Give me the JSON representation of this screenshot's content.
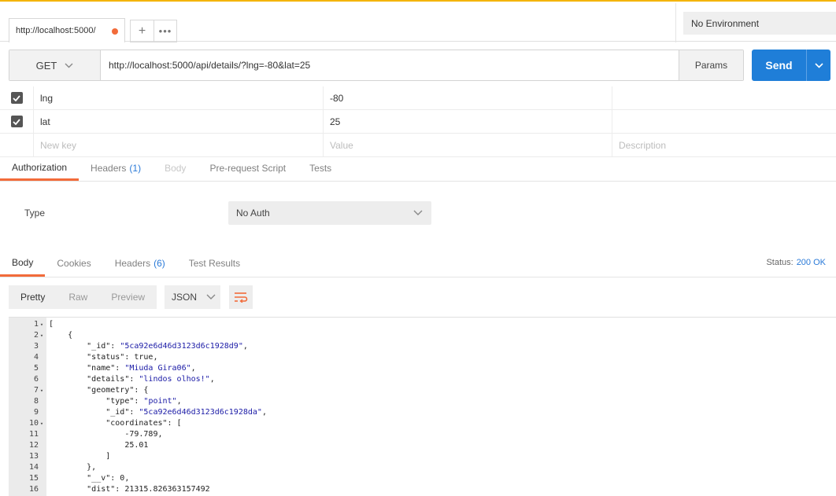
{
  "tab": {
    "title": "http://localhost:5000/"
  },
  "environment": {
    "selected": "No Environment"
  },
  "request": {
    "method": "GET",
    "url": "http://localhost:5000/api/details/?lng=-80&lat=25",
    "params_label": "Params",
    "send_label": "Send"
  },
  "params": {
    "rows": [
      {
        "key": "lng",
        "value": "-80",
        "checked": true
      },
      {
        "key": "lat",
        "value": "25",
        "checked": true
      }
    ],
    "placeholder": {
      "key": "New key",
      "value": "Value",
      "description": "Description"
    }
  },
  "request_tabs": [
    {
      "label": "Authorization",
      "active": true
    },
    {
      "label": "Headers",
      "count": "(1)"
    },
    {
      "label": "Body",
      "disabled": true
    },
    {
      "label": "Pre-request Script"
    },
    {
      "label": "Tests"
    }
  ],
  "auth": {
    "type_label": "Type",
    "type_value": "No Auth"
  },
  "response_tabs": [
    {
      "label": "Body",
      "active": true
    },
    {
      "label": "Cookies"
    },
    {
      "label": "Headers",
      "count": "(6)"
    },
    {
      "label": "Test Results"
    }
  ],
  "status": {
    "label": "Status:",
    "value": "200 OK"
  },
  "view": {
    "modes": [
      "Pretty",
      "Raw",
      "Preview"
    ],
    "active_mode": "Pretty",
    "format": "JSON"
  },
  "code_lines": [
    {
      "n": "1",
      "fold": true,
      "text": "["
    },
    {
      "n": "2",
      "fold": true,
      "text": "    {"
    },
    {
      "n": "3",
      "text": "        \"_id\": \"5ca92e6d46d3123d6c1928d9\","
    },
    {
      "n": "4",
      "text": "        \"status\": true,"
    },
    {
      "n": "5",
      "text": "        \"name\": \"Miuda Gira06\","
    },
    {
      "n": "6",
      "text": "        \"details\": \"lindos olhos!\","
    },
    {
      "n": "7",
      "fold": true,
      "text": "        \"geometry\": {"
    },
    {
      "n": "8",
      "text": "            \"type\": \"point\","
    },
    {
      "n": "9",
      "text": "            \"_id\": \"5ca92e6d46d3123d6c1928da\","
    },
    {
      "n": "10",
      "fold": true,
      "text": "            \"coordinates\": ["
    },
    {
      "n": "11",
      "text": "                -79.789,"
    },
    {
      "n": "12",
      "text": "                25.01"
    },
    {
      "n": "13",
      "text": "            ]"
    },
    {
      "n": "14",
      "text": "        },"
    },
    {
      "n": "15",
      "text": "        \"__v\": 0,"
    },
    {
      "n": "16",
      "text": "        \"dist\": 21315.826363157492"
    }
  ]
}
